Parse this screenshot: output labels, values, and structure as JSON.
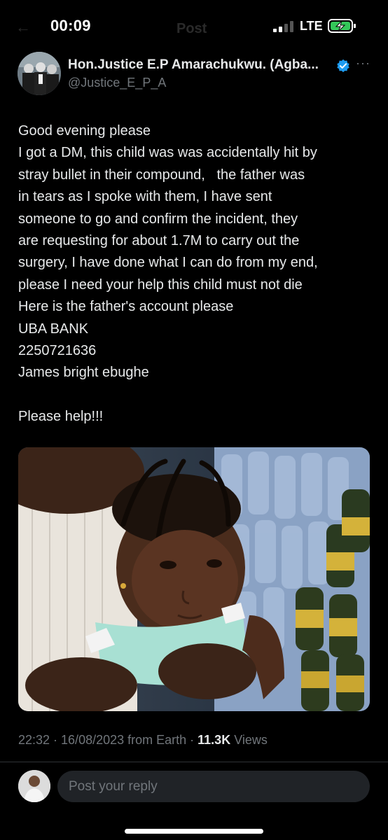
{
  "status_bar": {
    "time": "00:09",
    "network": "LTE",
    "faded_title": "Post"
  },
  "author": {
    "name": "Hon.Justice E.P Amarachukwu. (Agba...",
    "handle": "@Justice_E_P_A",
    "verified": true,
    "verified_color": "#1d9bf0"
  },
  "tweet": {
    "lines": [
      "Good evening please",
      "I got a DM, this child was was accidentally hit by",
      "stray bullet in their compound,   the father was",
      "in tears as I spoke with them, I have sent",
      "someone to go and confirm the incident, they",
      "are requesting for about 1.7M to carry out the",
      "surgery, I have done what I can do from my end,",
      "please I need your help this child must not die",
      "Here is the father's account please",
      "UBA BANK",
      "2250721636",
      "James bright ebughe",
      "",
      "Please help!!!"
    ],
    "timestamp": "22:32 · 16/08/2023 from Earth · ",
    "views_count": "11.3K",
    "views_label": " Views"
  },
  "reply": {
    "placeholder": "Post your reply"
  },
  "colors": {
    "background": "#000000",
    "text": "#e7e9ea",
    "muted": "#71767b",
    "reply_box": "#202327"
  }
}
